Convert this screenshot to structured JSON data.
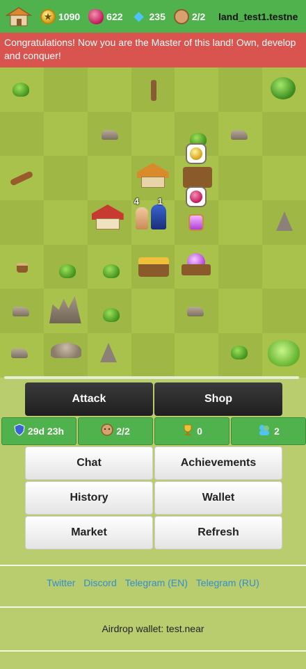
{
  "resources": {
    "coins": "1090",
    "gems": "622",
    "diamonds": "235",
    "heroes": "2/2",
    "land_name": "land_test1.testne"
  },
  "banner": {
    "message": "Congratulations! Now you are the Master of this land! Own, develop and conquer!"
  },
  "map": {
    "hero_counts": [
      "4",
      "1"
    ]
  },
  "actions": {
    "attack_label": "Attack",
    "shop_label": "Shop"
  },
  "stats": {
    "shield_time": "29d 23h",
    "heroes": "2/2",
    "trophies": "0",
    "population": "2"
  },
  "menu": {
    "chat": "Chat",
    "achievements": "Achievements",
    "history": "History",
    "wallet": "Wallet",
    "market": "Market",
    "refresh": "Refresh"
  },
  "links": {
    "twitter": "Twitter",
    "discord": "Discord",
    "telegram_en": "Telegram (EN)",
    "telegram_ru": "Telegram (RU)"
  },
  "airdrop": {
    "text": "Airdrop wallet: test.near"
  },
  "colors": {
    "topbar": "#4fb24c",
    "banner": "#d9534f",
    "grass_light": "#a9c24c",
    "grass_dark": "#9fb845",
    "link": "#2f8fcf"
  }
}
